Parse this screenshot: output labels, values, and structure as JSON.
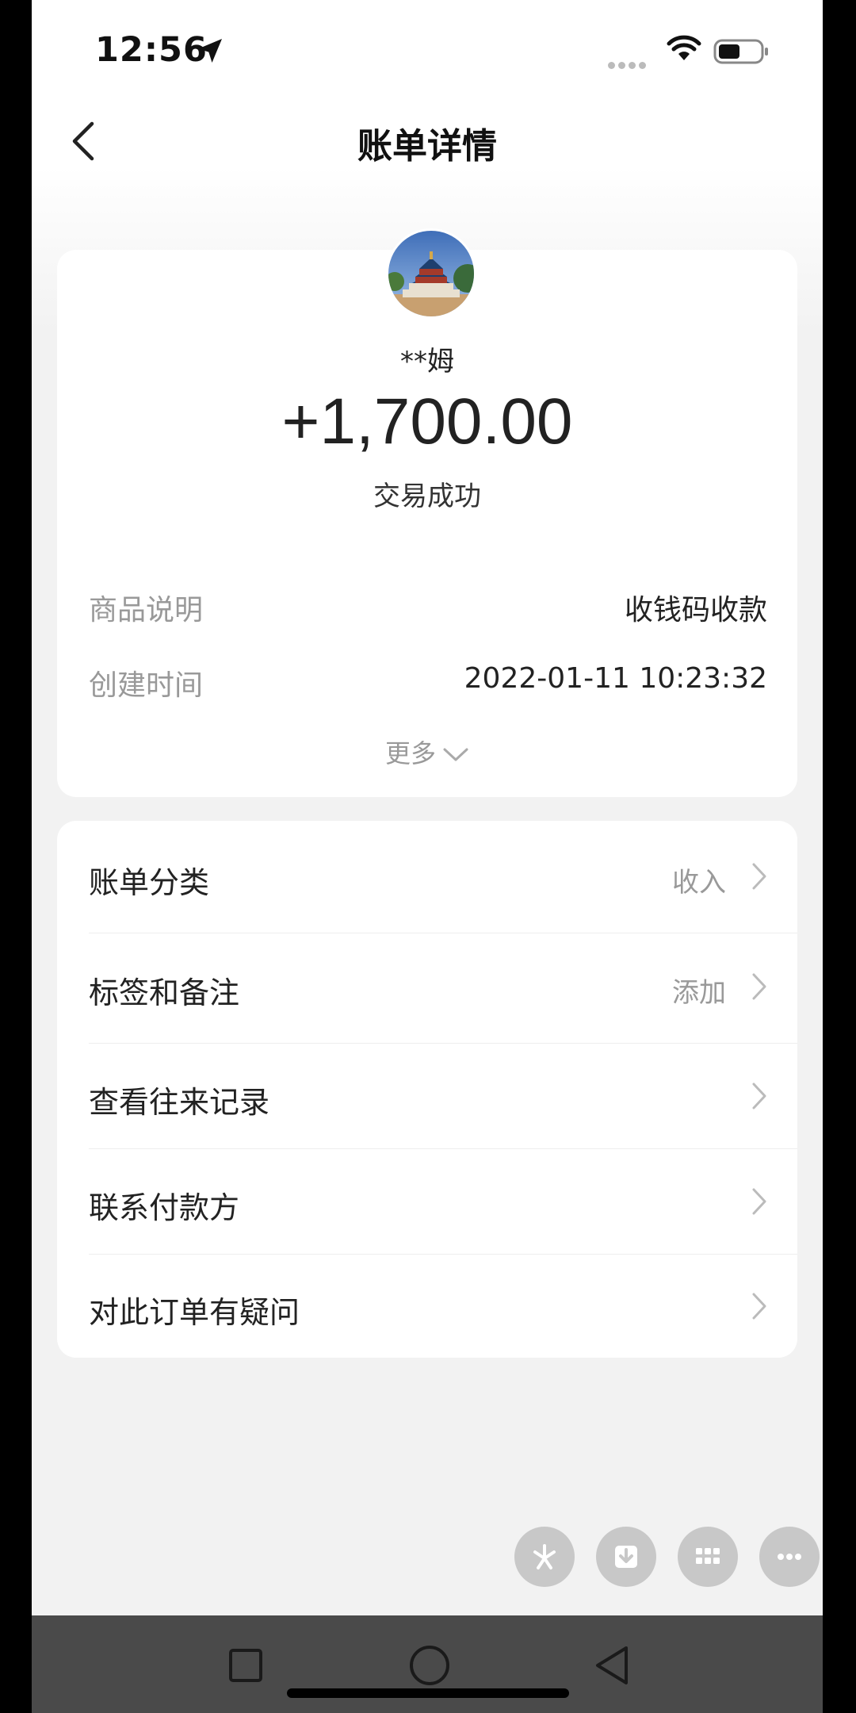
{
  "status_bar": {
    "time": "12:56"
  },
  "header": {
    "title": "账单详情"
  },
  "summary": {
    "name": "**姆",
    "amount": "+1,700.00",
    "status": "交易成功"
  },
  "details": [
    {
      "label": "商品说明",
      "value": "收钱码收款"
    },
    {
      "label": "创建时间",
      "value": "2022-01-11 10:23:32"
    }
  ],
  "more_label": "更多",
  "menu": [
    {
      "label": "账单分类",
      "value": "收入"
    },
    {
      "label": "标签和备注",
      "value": "添加"
    },
    {
      "label": "查看往来记录",
      "value": ""
    },
    {
      "label": "联系付款方",
      "value": ""
    },
    {
      "label": "对此订单有疑问",
      "value": ""
    }
  ],
  "colors": {
    "accent_text": "#222222",
    "secondary_text": "#999999",
    "fab_bg": "#c8c8c8",
    "nav_bar_bg": "#4a4a4a"
  }
}
